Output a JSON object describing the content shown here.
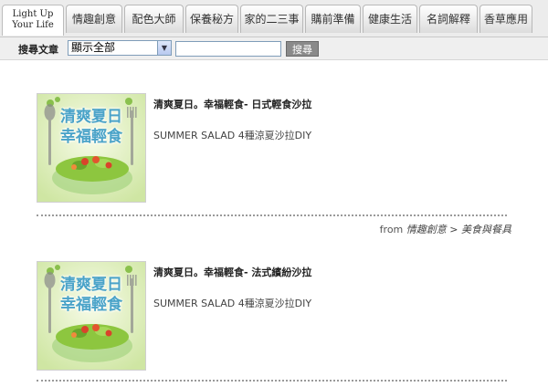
{
  "nav": {
    "logo_line1": "Light Up",
    "logo_line2": "Your Life",
    "tabs": [
      "情趣創意",
      "配色大師",
      "保養秘方",
      "家的二三事",
      "購前準備",
      "健康生活",
      "名詞解釋",
      "香草應用"
    ]
  },
  "search": {
    "label": "搜尋文章",
    "category_selected": "顯示全部",
    "input_value": "",
    "button_label": "搜尋"
  },
  "articles": [
    {
      "thumb_line1": "清爽夏日",
      "thumb_line2": "幸福輕食",
      "title": "清爽夏日。幸福輕食- 日式輕食沙拉",
      "subtitle": "SUMMER SALAD 4種涼夏沙拉DIY",
      "from_prefix": "from",
      "category": "情趣創意",
      "sep": ">",
      "subcategory": "美食與餐具"
    },
    {
      "thumb_line1": "清爽夏日",
      "thumb_line2": "幸福輕食",
      "title": "清爽夏日。幸福輕食- 法式繽紛沙拉",
      "subtitle": "SUMMER SALAD 4種涼夏沙拉DIY"
    }
  ],
  "colors": {
    "thumb_text": "#4aa3c8",
    "thumb_bg": "#e6f3c8",
    "salad_green": "#8dc63f",
    "tomato": "#d9432b"
  }
}
